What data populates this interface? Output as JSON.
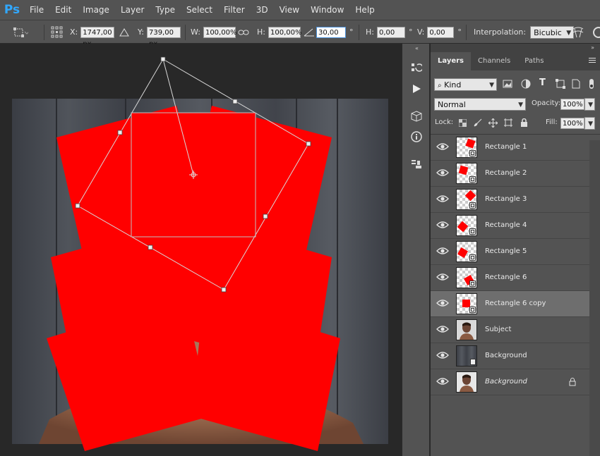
{
  "app": {
    "logo": "Ps"
  },
  "menu": [
    "File",
    "Edit",
    "Image",
    "Layer",
    "Type",
    "Select",
    "Filter",
    "3D",
    "View",
    "Window",
    "Help"
  ],
  "options": {
    "x_label": "X:",
    "x_value": "1747,00 px",
    "y_label": "Y:",
    "y_value": "739,00 px",
    "w_label": "W:",
    "w_value": "100,00%",
    "h_label": "H:",
    "h_value": "100,00%",
    "angle_value": "30,00",
    "angle_unit": "°",
    "hskew_label": "H:",
    "hskew_value": "0,00",
    "hskew_unit": "°",
    "vskew_label": "V:",
    "vskew_value": "0,00",
    "vskew_unit": "°",
    "interp_label": "Interpolation:",
    "interp_value": "Bicubic"
  },
  "panel": {
    "tabs": [
      "Layers",
      "Channels",
      "Paths"
    ],
    "filter_kind": "Kind",
    "blend_mode": "Normal",
    "opacity_label": "Opacity:",
    "opacity_value": "100%",
    "lock_label": "Lock:",
    "fill_label": "Fill:",
    "fill_value": "100%"
  },
  "layers": [
    {
      "name": "Rectangle 1",
      "thumb": "rect",
      "rot": 20,
      "pos": "tr"
    },
    {
      "name": "Rectangle 2",
      "thumb": "rect",
      "rot": 15,
      "pos": "tl"
    },
    {
      "name": "Rectangle 3",
      "thumb": "rect",
      "rot": 45,
      "pos": "tr"
    },
    {
      "name": "Rectangle 4",
      "thumb": "rect",
      "rot": 40,
      "pos": "l"
    },
    {
      "name": "Rectangle 5",
      "thumb": "rect",
      "rot": 30,
      "pos": "l"
    },
    {
      "name": "Rectangle 6",
      "thumb": "rect",
      "rot": 60,
      "pos": "b"
    },
    {
      "name": "Rectangle 6 copy",
      "thumb": "rect",
      "rot": 0,
      "pos": "c",
      "selected": true
    },
    {
      "name": "Subject",
      "thumb": "person"
    },
    {
      "name": "Background",
      "thumb": "wood"
    },
    {
      "name": "Background",
      "thumb": "person-bg",
      "italic": true,
      "locked": true
    }
  ],
  "colors": {
    "accent": "#31a8ff",
    "shape": "#ff0000"
  }
}
